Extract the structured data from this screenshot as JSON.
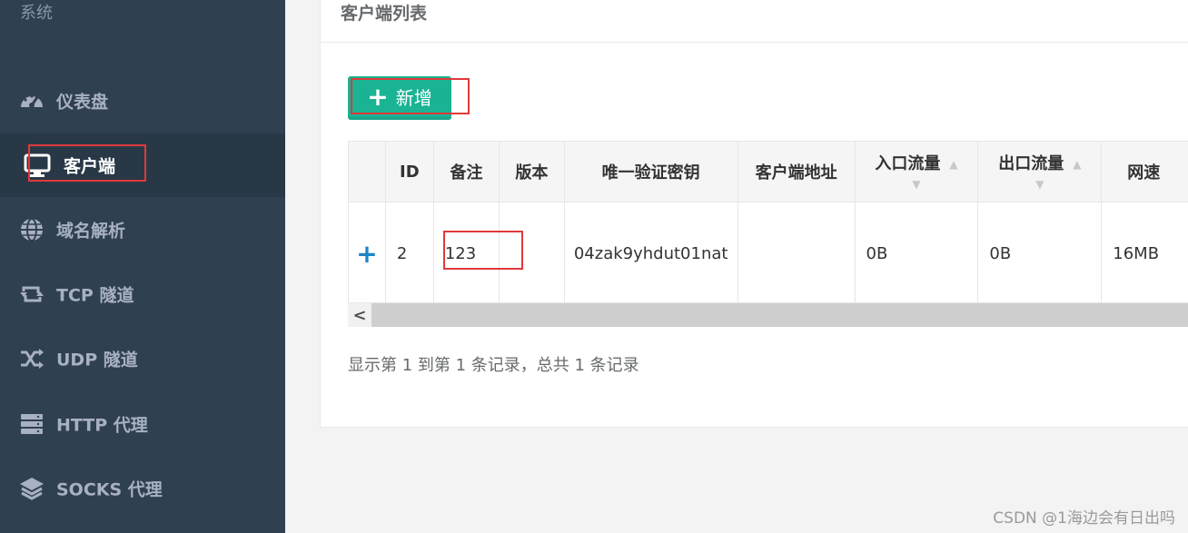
{
  "sidebar": {
    "top_label": "系统",
    "items": [
      {
        "label": "仪表盘",
        "icon": "dashboard-icon"
      },
      {
        "label": "客户端",
        "icon": "monitor-icon"
      },
      {
        "label": "域名解析",
        "icon": "globe-icon"
      },
      {
        "label": "TCP 隧道",
        "icon": "retweet-icon"
      },
      {
        "label": "UDP 隧道",
        "icon": "random-icon"
      },
      {
        "label": "HTTP 代理",
        "icon": "server-icon"
      },
      {
        "label": "SOCKS 代理",
        "icon": "layers-icon"
      }
    ]
  },
  "panel": {
    "title": "客户端列表",
    "add_button_label": "新增",
    "table": {
      "headers": [
        "ID",
        "备注",
        "版本",
        "唯一验证密钥",
        "客户端地址",
        "入口流量",
        "出口流量",
        "网速"
      ],
      "rows": [
        {
          "expand": "+",
          "id": "2",
          "remark": "123",
          "version": "",
          "key": "04zak9yhdut01nat",
          "address": "",
          "in_flow": "0B",
          "out_flow": "0B",
          "speed": "16MB"
        }
      ]
    },
    "scroll_left_label": "<",
    "pagination_text": "显示第 1 到第 1 条记录，总共 1 条记录"
  },
  "watermark": "CSDN @1海边会有日出吗",
  "colors": {
    "sidebar_bg": "#2f4050",
    "sidebar_active_bg": "#293846",
    "primary_button": "#1ab394",
    "expand_icon": "#1c84c6",
    "highlight_box": "#e03a3a"
  }
}
